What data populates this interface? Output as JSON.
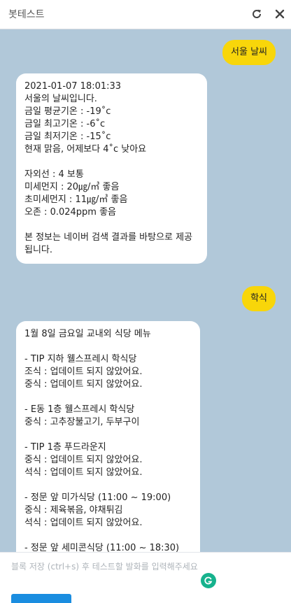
{
  "header": {
    "title": "봇테스트",
    "refresh_icon": "refresh-icon",
    "close_icon": "close-icon"
  },
  "messages": [
    {
      "sender": "user",
      "text": "서울 날씨"
    },
    {
      "sender": "bot",
      "text": "2021-01-07 18:01:33\n서울의 날씨입니다.\n금일 평균기온 : -19˚c\n금일 최고기온 : -6˚c\n금일 최저기온 : -15˚c\n현재 맑음, 어제보다 4˚c 낮아요\n\n자외선 : 4 보통\n미세먼지 : 20㎍/㎥ 좋음\n초미세먼지 : 11㎍/㎥ 좋음\n오존 : 0.024ppm 좋음\n\n본 정보는 네이버 검색 결과를 바탕으로 제공됩니다."
    },
    {
      "sender": "user",
      "text": "학식"
    },
    {
      "sender": "bot",
      "text": "1월 8일 금요일 교내외 식당 메뉴\n\n- TIP 지하 웰스프레시 학식당\n조식 : 업데이트 되지 않았어요.\n중식 : 업데이트 되지 않았어요.\n\n- E동 1층 웰스프레시 학식당\n중식 : 고추장불고기, 두부구이\n\n- TIP 1층 푸드라운지\n중식 : 업데이트 되지 않았어요.\n석식 : 업데이트 되지 않았어요.\n\n- 정문 앞 미가식당 (11:00 ~ 19:00)\n중식 : 제육볶음, 야채튀김\n석식 : 업데이트 되지 않았어요.\n\n- 정문 앞 세미콘식당 (11:00 ~ 18:30)"
    }
  ],
  "input": {
    "placeholder": "블록 저장 (ctrl+s) 후 테스트할 발화를 입력해주세요",
    "grammar_icon": "grammarly-icon"
  },
  "colors": {
    "chat_background": "#b1c8d9",
    "user_bubble": "#f8d60a",
    "bot_bubble": "#ffffff",
    "send_button": "#1a8de0",
    "grammar_icon": "#16b28d"
  }
}
